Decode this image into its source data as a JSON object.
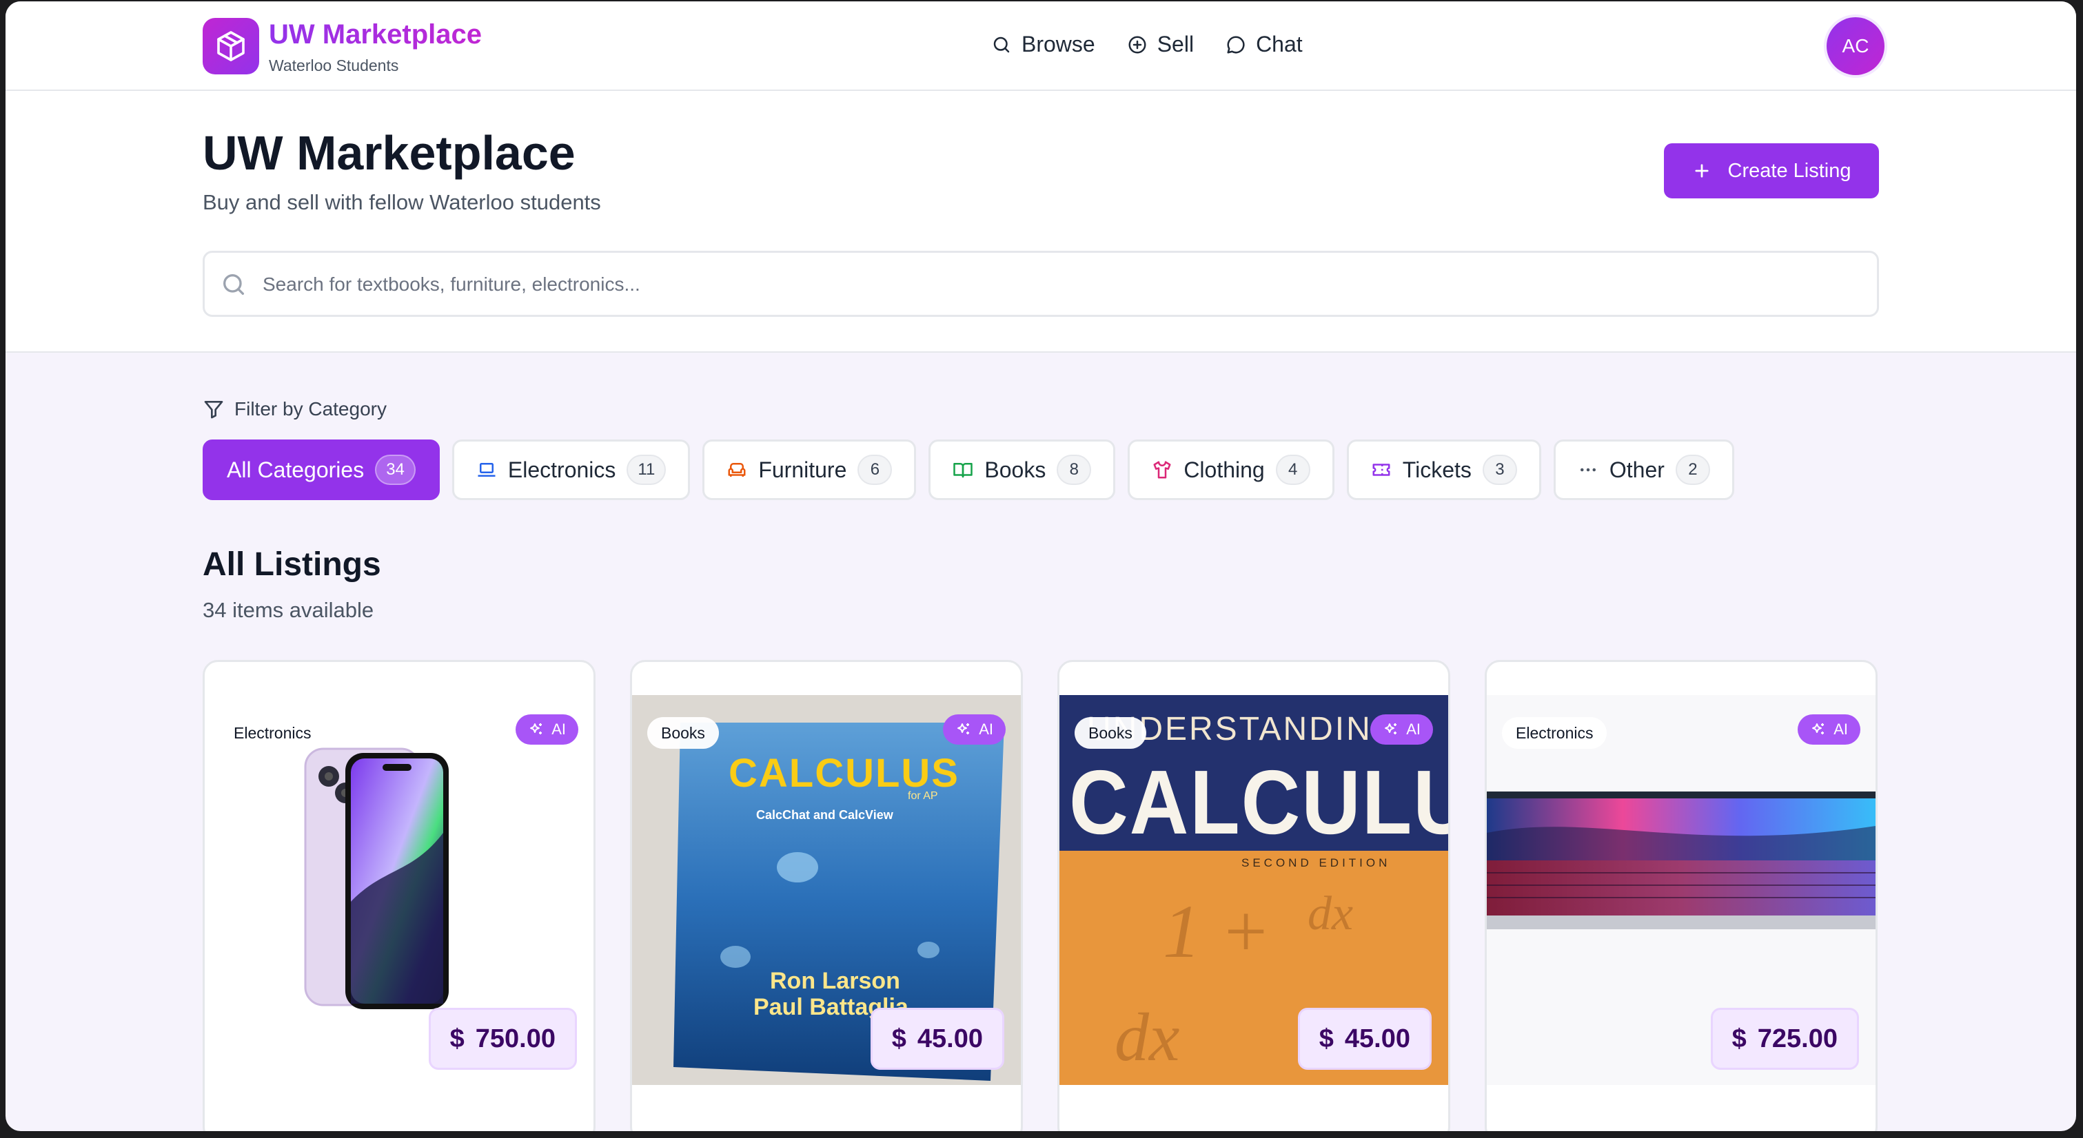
{
  "nav": {
    "brand_title": "UW Marketplace",
    "brand_subtitle": "Waterloo Students",
    "links": [
      {
        "label": "Browse",
        "icon": "search-icon"
      },
      {
        "label": "Sell",
        "icon": "plus-circle-icon"
      },
      {
        "label": "Chat",
        "icon": "chat-bubble-icon"
      }
    ],
    "avatar_initials": "AC"
  },
  "header": {
    "title": "UW Marketplace",
    "subtitle": "Buy and sell with fellow Waterloo students",
    "create_button": "Create Listing",
    "search_placeholder": "Search for textbooks, furniture, electronics..."
  },
  "filter": {
    "label": "Filter by Category",
    "categories": [
      {
        "label": "All Categories",
        "count": "34",
        "icon": "",
        "active": true
      },
      {
        "label": "Electronics",
        "count": "11",
        "icon": "laptop-icon",
        "color": "#2563eb"
      },
      {
        "label": "Furniture",
        "count": "6",
        "icon": "sofa-icon",
        "color": "#ea580c"
      },
      {
        "label": "Books",
        "count": "8",
        "icon": "book-open-icon",
        "color": "#16a34a"
      },
      {
        "label": "Clothing",
        "count": "4",
        "icon": "shirt-icon",
        "color": "#db2777"
      },
      {
        "label": "Tickets",
        "count": "3",
        "icon": "ticket-icon",
        "color": "#9333ea"
      },
      {
        "label": "Other",
        "count": "2",
        "icon": "more-horizontal-icon",
        "color": "#4b5563"
      }
    ]
  },
  "listings": {
    "title": "All Listings",
    "count_text": "34 items available",
    "ai_label": "AI",
    "currency_symbol": "$",
    "items": [
      {
        "category": "Electronics",
        "price": "750.00",
        "image": "iphone-image"
      },
      {
        "category": "Books",
        "price": "45.00",
        "image": "calculus-ap-book-image",
        "cover_title": "CALCULUS",
        "cover_sub": "for AP",
        "cover_mid": "CalcChat and CalcView",
        "cover_authors_1": "Ron Larson",
        "cover_authors_2": "Paul Battaglia"
      },
      {
        "category": "Books",
        "price": "45.00",
        "image": "understanding-calculus-book-image",
        "cover_top": "UNDERSTANDING",
        "cover_title": "CALCULUS",
        "cover_edition": "SECOND EDITION"
      },
      {
        "category": "Electronics",
        "price": "725.00",
        "image": "macbook-image"
      }
    ]
  },
  "colors": {
    "accent": "#9333ea",
    "accent_light": "#f3e8ff",
    "brand_gradient_end": "#c026d3"
  }
}
